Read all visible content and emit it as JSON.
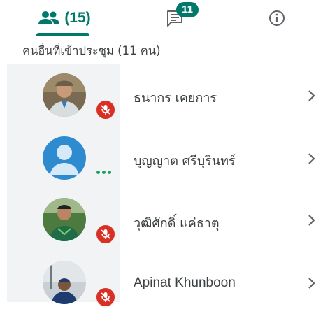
{
  "tabs": {
    "people_count": "(15)",
    "chat_badge": "11",
    "people_icon": "people-icon",
    "chat_icon": "chat-icon",
    "info_icon": "info-icon"
  },
  "section": {
    "title": "คนอื่นที่เข้าประชุม (11 คน)"
  },
  "participants": [
    {
      "name": "ธนากร เคยการ",
      "status": "muted"
    },
    {
      "name": "บุญญาต ศรีบุรินทร์",
      "status": "more"
    },
    {
      "name": "วุฒิศักดิ์ แค่ธาตุ",
      "status": "muted"
    },
    {
      "name": "Apinat Khunboon",
      "status": "muted"
    }
  ],
  "colors": {
    "accent": "#00796b",
    "muted": "#d93025",
    "panel": "#f1f3f4"
  }
}
